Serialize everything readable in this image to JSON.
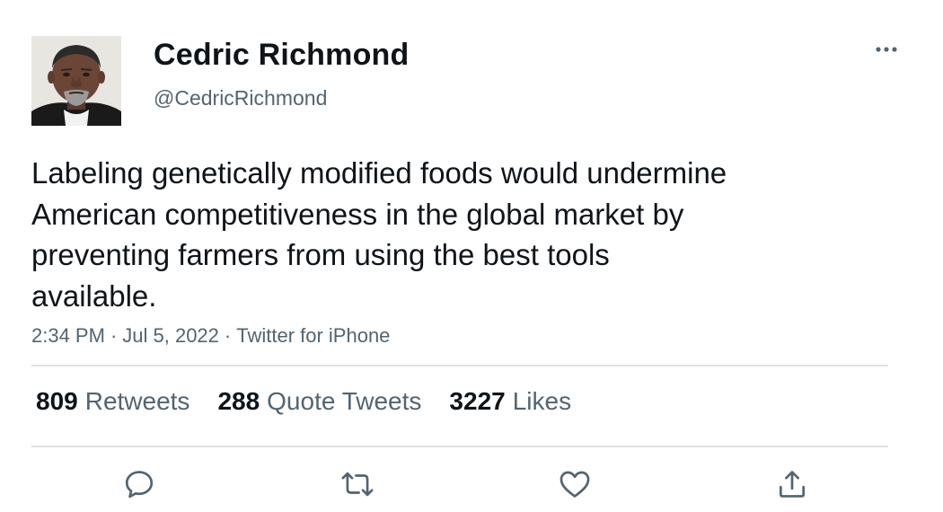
{
  "author": {
    "display_name": "Cedric Richmond",
    "handle": "@CedricRichmond",
    "avatar_icon": "profile-photo"
  },
  "tweet": {
    "text_lines": [
      "Labeling genetically modified foods would undermine",
      "American competitiveness in the global market by",
      "preventing farmers from using the best tools",
      "available."
    ],
    "time": "2:34 PM",
    "date": "Jul 5, 2022",
    "source": "Twitter for iPhone",
    "separator": "·"
  },
  "stats": {
    "retweets_count": "809",
    "retweets_label": "Retweets",
    "quotes_count": "288",
    "quotes_label": "Quote Tweets",
    "likes_count": "3227",
    "likes_label": "Likes"
  },
  "actions": {
    "reply_icon": "reply-icon",
    "retweet_icon": "retweet-icon",
    "like_icon": "heart-icon",
    "share_icon": "share-icon"
  },
  "colors": {
    "text_primary": "#0f1419",
    "text_secondary": "#536471",
    "divider": "#dde2e6"
  }
}
